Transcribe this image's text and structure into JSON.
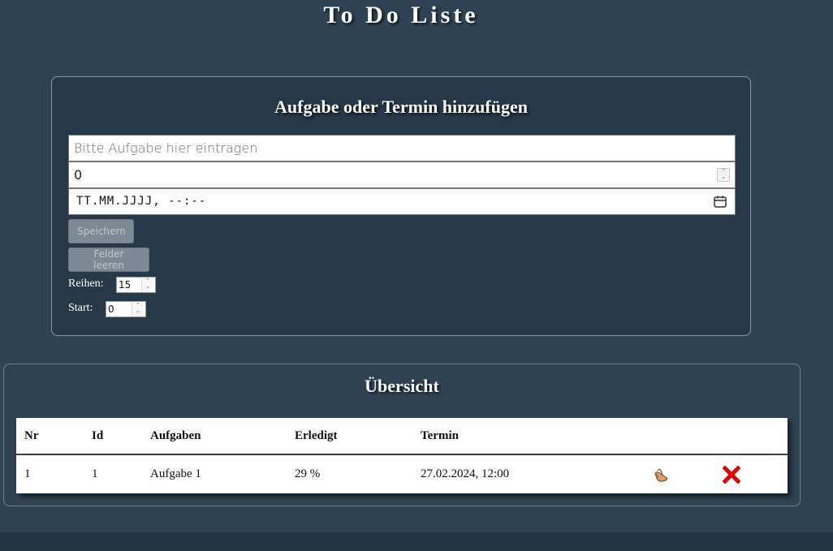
{
  "header": {
    "title": "To Do Liste"
  },
  "form": {
    "title": "Aufgabe oder Termin hinzufügen",
    "task_placeholder": "Bitte Aufgabe hier eintragen",
    "task_value": "",
    "number_value": "0",
    "date_placeholder": "TT.MM.JJJJ, --:--",
    "save_label": "Speichern",
    "clear_label": "Felder leeren",
    "rows_label": "Reihen:",
    "rows_value": "15",
    "start_label": "Start:",
    "start_value": "0"
  },
  "overview": {
    "title": "Übersicht",
    "columns": [
      "Nr",
      "Id",
      "Aufgaben",
      "Erledigt",
      "Termin"
    ],
    "rows": [
      {
        "nr": "1",
        "id": "1",
        "task": "Aufgabe 1",
        "done": "29 %",
        "date": "27.02.2024, 12:00",
        "edit_icon": "hand-edit-icon",
        "delete_icon": "red-x-delete-icon"
      }
    ]
  },
  "colors": {
    "background": "#2f4354",
    "card": "#273848",
    "delete": "#e00000",
    "button": "#7d8a95"
  }
}
